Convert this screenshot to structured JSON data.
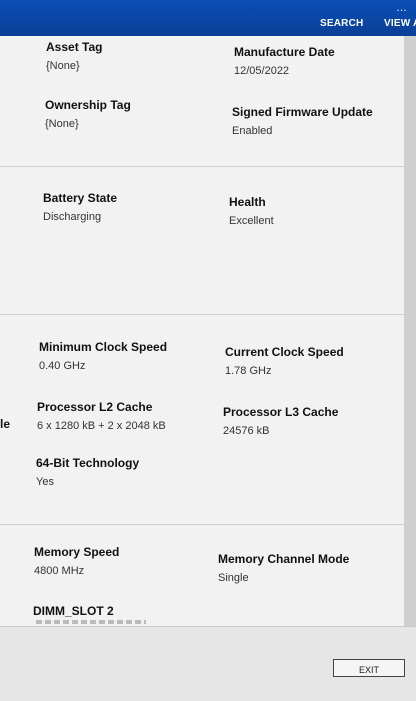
{
  "header": {
    "search_label": "SEARCH",
    "view_all_label": "VIEW AL",
    "accent_color": "#0b4aa8"
  },
  "asset": {
    "asset_tag_label": "Asset Tag",
    "asset_tag_value": "{None}",
    "manufacture_date_label": "Manufacture Date",
    "manufacture_date_value": "12/05/2022",
    "ownership_tag_label": "Ownership Tag",
    "ownership_tag_value": "{None}",
    "signed_firmware_label": "Signed Firmware Update",
    "signed_firmware_value": "Enabled"
  },
  "battery": {
    "state_label": "Battery State",
    "state_value": "Discharging",
    "health_label": "Health",
    "health_value": "Excellent"
  },
  "processor": {
    "min_clock_label": "Minimum Clock Speed",
    "min_clock_value": "0.40 GHz",
    "current_clock_label": "Current Clock Speed",
    "current_clock_value": "1.78 GHz",
    "l2_cache_label": "Processor L2 Cache",
    "l2_cache_value": "6 x 1280  kB + 2 x 2048  kB",
    "l3_cache_label": "Processor L3 Cache",
    "l3_cache_value": "24576 kB",
    "left_cut_text": "le",
    "bit64_label": "64-Bit Technology",
    "bit64_value": "Yes"
  },
  "memory": {
    "speed_label": "Memory Speed",
    "speed_value": "4800 MHz",
    "channel_mode_label": "Memory Channel Mode",
    "channel_mode_value": "Single",
    "dimm_slot_label": "DIMM_SLOT 2"
  },
  "footer": {
    "exit_label": "EXIT"
  }
}
